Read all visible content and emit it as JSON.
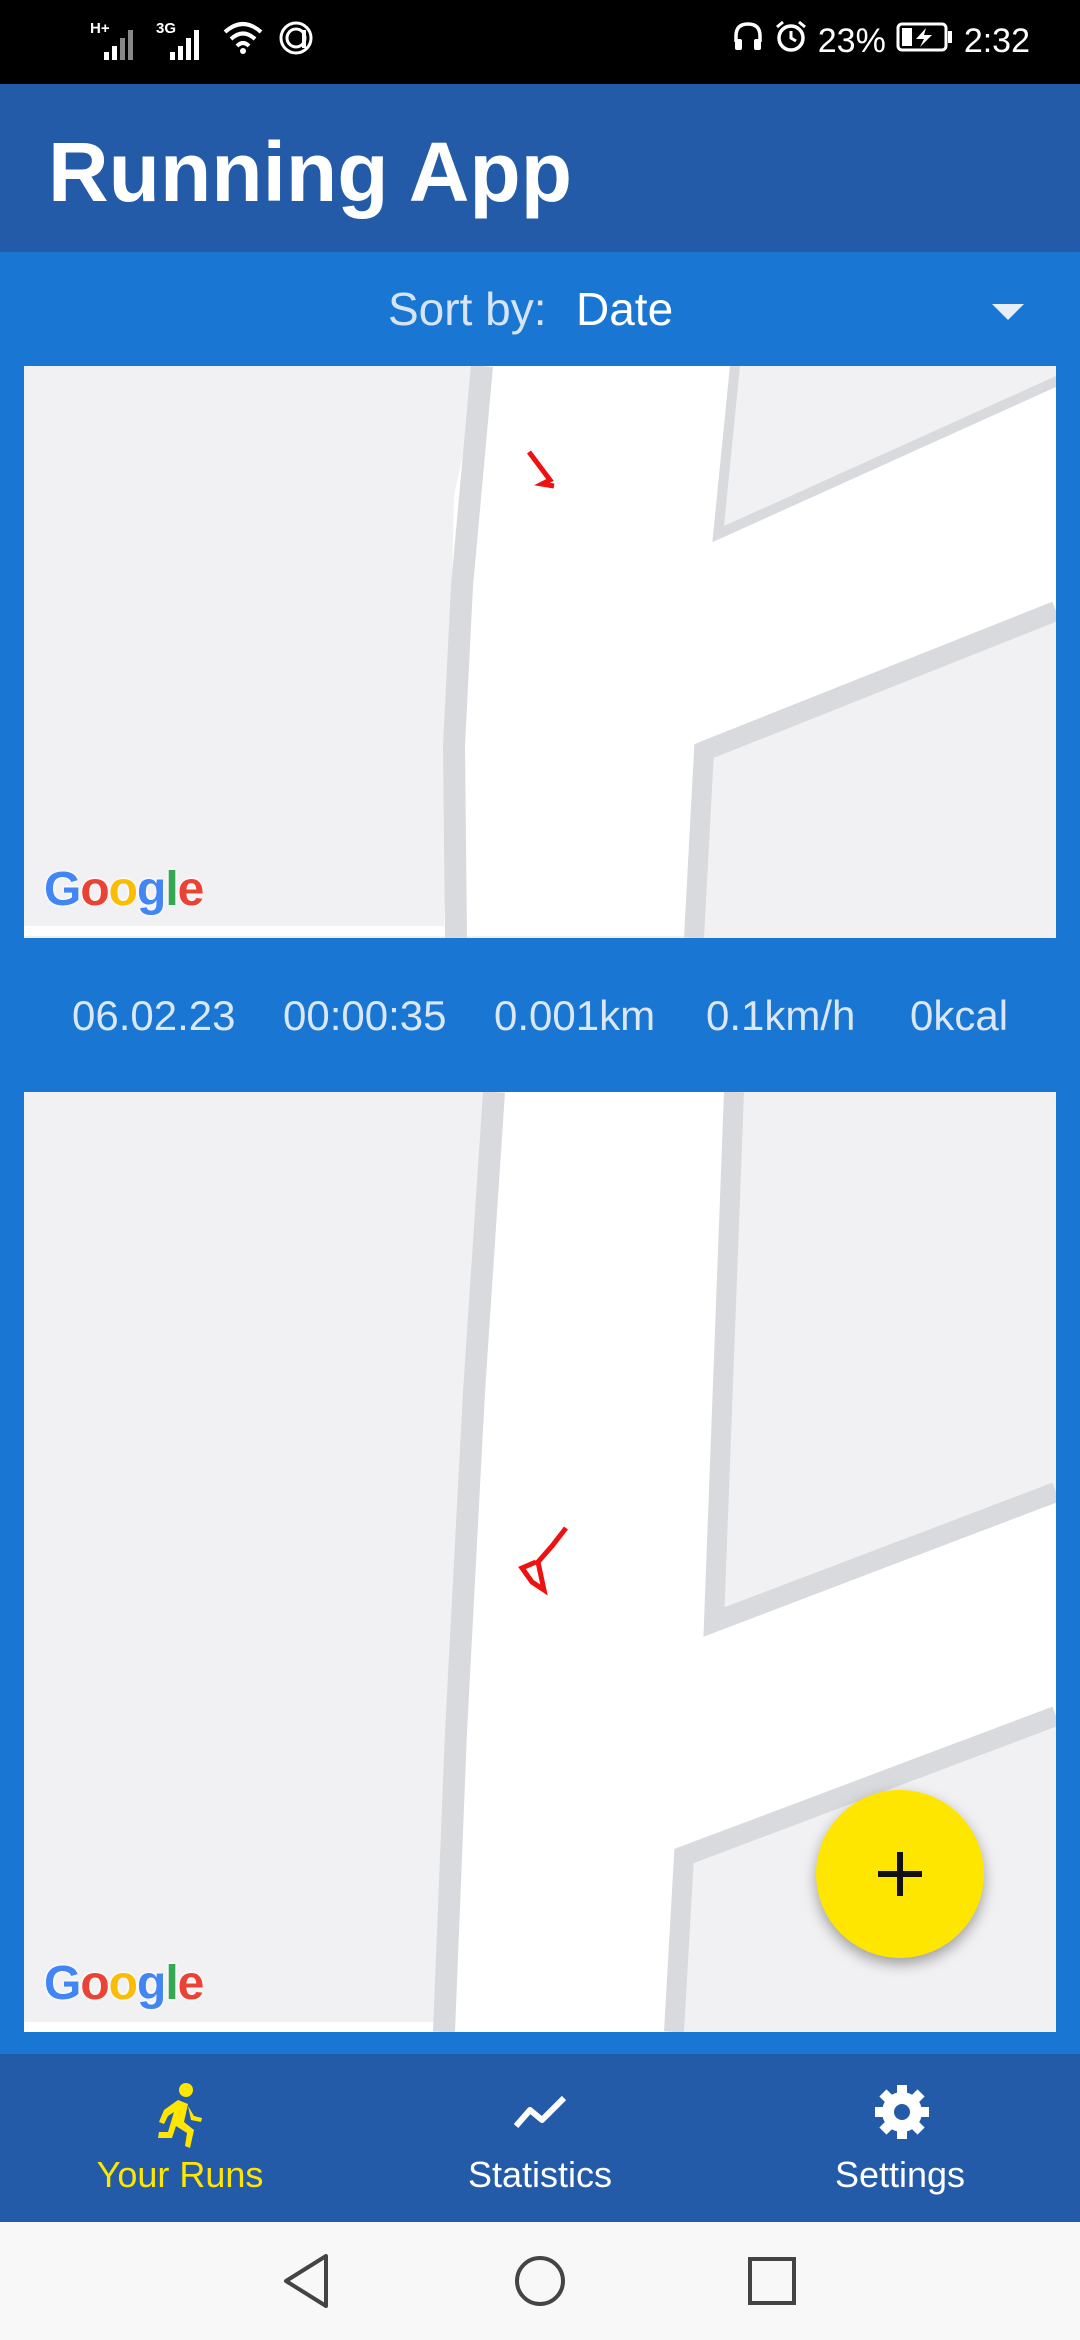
{
  "status_bar": {
    "network_1": "H+",
    "network_2": "3G",
    "battery": "23%",
    "time": "2:32",
    "icons": [
      "signal-icon",
      "signal-icon",
      "wifi-icon",
      "data-icon",
      "headphones-icon",
      "alarm-icon",
      "battery-charging-icon"
    ]
  },
  "app_bar": {
    "title": "Running App"
  },
  "sort": {
    "label": "Sort by:",
    "value": "Date"
  },
  "runs": [
    {
      "map_attribution": "Google",
      "date": "06.02.23",
      "duration": "00:00:35",
      "distance": "0.001km",
      "speed": "0.1km/h",
      "calories": "0kcal"
    },
    {
      "map_attribution": "Google"
    }
  ],
  "fab": {
    "icon": "plus-icon"
  },
  "bottom_nav": {
    "items": [
      {
        "label": "Your Runs",
        "icon": "runner-icon",
        "active": true
      },
      {
        "label": "Statistics",
        "icon": "trending-up-icon",
        "active": false
      },
      {
        "label": "Settings",
        "icon": "gear-icon",
        "active": false
      }
    ]
  },
  "system_nav": {
    "icons": [
      "back-icon",
      "home-icon",
      "recents-icon"
    ]
  },
  "colors": {
    "primary": "#1976d2",
    "primary_dark": "#245ba8",
    "accent": "#ffe600",
    "route": "#ee1111"
  }
}
